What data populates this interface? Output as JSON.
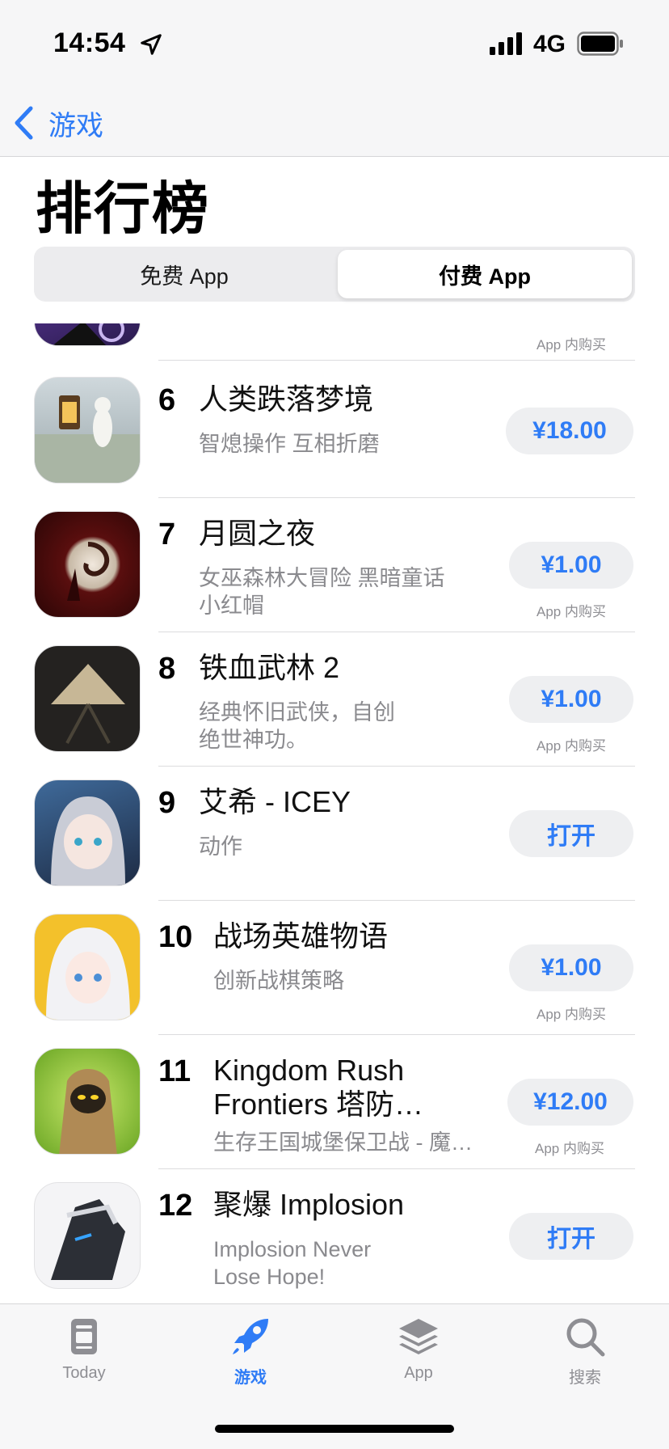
{
  "status_bar": {
    "time": "14:54",
    "network": "4G"
  },
  "nav": {
    "back_label": "游戏"
  },
  "page_title": "排行榜",
  "segmented": {
    "free_label": "免费 App",
    "paid_label": "付费 App",
    "selected": "paid"
  },
  "iap_label": "App 内购买",
  "apps": [
    {
      "rank": "6",
      "name": "人类跌落梦境",
      "subtitle": [
        "智熄操作 互相折磨"
      ],
      "button": "¥18.00",
      "iap": false,
      "icon": "human-fall-flat-icon"
    },
    {
      "rank": "7",
      "name": "月圆之夜",
      "subtitle": [
        "女巫森林大冒险 黑暗童话",
        "小红帽"
      ],
      "button": "¥1.00",
      "iap": true,
      "icon": "night-of-full-moon-icon"
    },
    {
      "rank": "8",
      "name": "铁血武林 2",
      "subtitle": [
        "经典怀旧武侠，自创",
        "绝世神功。"
      ],
      "button": "¥1.00",
      "iap": true,
      "icon": "tiexue-wulin-icon"
    },
    {
      "rank": "9",
      "name": "艾希 - ICEY",
      "subtitle": [
        "动作"
      ],
      "button": "打开",
      "iap": false,
      "icon": "icey-icon"
    },
    {
      "rank": "10",
      "name": "战场英雄物语",
      "subtitle": [
        "创新战棋策略"
      ],
      "button": "¥1.00",
      "iap": true,
      "icon": "battlefield-heroes-icon"
    },
    {
      "rank": "11",
      "name": "Kingdom Rush Frontiers 塔防...",
      "name_lines": [
        "Kingdom Rush",
        "Frontiers 塔防…"
      ],
      "subtitle": [
        "生存王国城堡保卫战 - 魔…"
      ],
      "button": "¥12.00",
      "iap": true,
      "icon": "kingdom-rush-icon"
    },
    {
      "rank": "12",
      "name": "聚爆 Implosion",
      "subtitle": [
        "Implosion Never",
        "Lose Hope!"
      ],
      "button": "打开",
      "iap": false,
      "icon": "implosion-icon"
    }
  ],
  "tabs": [
    {
      "label": "Today",
      "icon": "today-icon",
      "active": false
    },
    {
      "label": "游戏",
      "icon": "rocket-icon",
      "active": true
    },
    {
      "label": "App",
      "icon": "layers-icon",
      "active": false
    },
    {
      "label": "搜索",
      "icon": "search-icon",
      "active": false
    }
  ],
  "colors": {
    "accent": "#2f7cf6",
    "secondary_text": "#8a8a8e",
    "button_bg": "#eeeff1"
  }
}
